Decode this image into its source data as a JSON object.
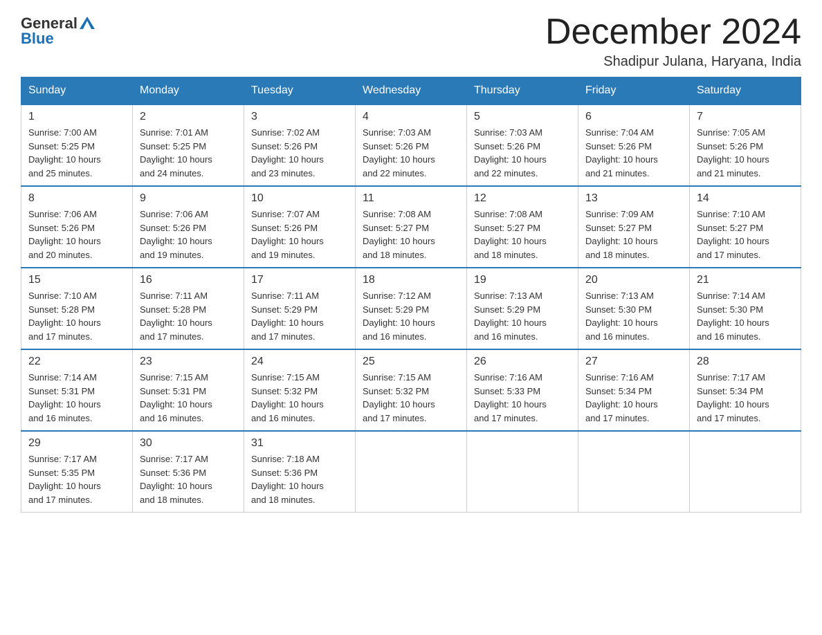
{
  "header": {
    "logo": {
      "general": "General",
      "blue": "Blue"
    },
    "title": "December 2024",
    "location": "Shadipur Julana, Haryana, India"
  },
  "days_of_week": [
    "Sunday",
    "Monday",
    "Tuesday",
    "Wednesday",
    "Thursday",
    "Friday",
    "Saturday"
  ],
  "weeks": [
    [
      {
        "day": "1",
        "sunrise": "7:00 AM",
        "sunset": "5:25 PM",
        "daylight": "10 hours and 25 minutes."
      },
      {
        "day": "2",
        "sunrise": "7:01 AM",
        "sunset": "5:25 PM",
        "daylight": "10 hours and 24 minutes."
      },
      {
        "day": "3",
        "sunrise": "7:02 AM",
        "sunset": "5:26 PM",
        "daylight": "10 hours and 23 minutes."
      },
      {
        "day": "4",
        "sunrise": "7:03 AM",
        "sunset": "5:26 PM",
        "daylight": "10 hours and 22 minutes."
      },
      {
        "day": "5",
        "sunrise": "7:03 AM",
        "sunset": "5:26 PM",
        "daylight": "10 hours and 22 minutes."
      },
      {
        "day": "6",
        "sunrise": "7:04 AM",
        "sunset": "5:26 PM",
        "daylight": "10 hours and 21 minutes."
      },
      {
        "day": "7",
        "sunrise": "7:05 AM",
        "sunset": "5:26 PM",
        "daylight": "10 hours and 21 minutes."
      }
    ],
    [
      {
        "day": "8",
        "sunrise": "7:06 AM",
        "sunset": "5:26 PM",
        "daylight": "10 hours and 20 minutes."
      },
      {
        "day": "9",
        "sunrise": "7:06 AM",
        "sunset": "5:26 PM",
        "daylight": "10 hours and 19 minutes."
      },
      {
        "day": "10",
        "sunrise": "7:07 AM",
        "sunset": "5:26 PM",
        "daylight": "10 hours and 19 minutes."
      },
      {
        "day": "11",
        "sunrise": "7:08 AM",
        "sunset": "5:27 PM",
        "daylight": "10 hours and 18 minutes."
      },
      {
        "day": "12",
        "sunrise": "7:08 AM",
        "sunset": "5:27 PM",
        "daylight": "10 hours and 18 minutes."
      },
      {
        "day": "13",
        "sunrise": "7:09 AM",
        "sunset": "5:27 PM",
        "daylight": "10 hours and 18 minutes."
      },
      {
        "day": "14",
        "sunrise": "7:10 AM",
        "sunset": "5:27 PM",
        "daylight": "10 hours and 17 minutes."
      }
    ],
    [
      {
        "day": "15",
        "sunrise": "7:10 AM",
        "sunset": "5:28 PM",
        "daylight": "10 hours and 17 minutes."
      },
      {
        "day": "16",
        "sunrise": "7:11 AM",
        "sunset": "5:28 PM",
        "daylight": "10 hours and 17 minutes."
      },
      {
        "day": "17",
        "sunrise": "7:11 AM",
        "sunset": "5:29 PM",
        "daylight": "10 hours and 17 minutes."
      },
      {
        "day": "18",
        "sunrise": "7:12 AM",
        "sunset": "5:29 PM",
        "daylight": "10 hours and 16 minutes."
      },
      {
        "day": "19",
        "sunrise": "7:13 AM",
        "sunset": "5:29 PM",
        "daylight": "10 hours and 16 minutes."
      },
      {
        "day": "20",
        "sunrise": "7:13 AM",
        "sunset": "5:30 PM",
        "daylight": "10 hours and 16 minutes."
      },
      {
        "day": "21",
        "sunrise": "7:14 AM",
        "sunset": "5:30 PM",
        "daylight": "10 hours and 16 minutes."
      }
    ],
    [
      {
        "day": "22",
        "sunrise": "7:14 AM",
        "sunset": "5:31 PM",
        "daylight": "10 hours and 16 minutes."
      },
      {
        "day": "23",
        "sunrise": "7:15 AM",
        "sunset": "5:31 PM",
        "daylight": "10 hours and 16 minutes."
      },
      {
        "day": "24",
        "sunrise": "7:15 AM",
        "sunset": "5:32 PM",
        "daylight": "10 hours and 16 minutes."
      },
      {
        "day": "25",
        "sunrise": "7:15 AM",
        "sunset": "5:32 PM",
        "daylight": "10 hours and 17 minutes."
      },
      {
        "day": "26",
        "sunrise": "7:16 AM",
        "sunset": "5:33 PM",
        "daylight": "10 hours and 17 minutes."
      },
      {
        "day": "27",
        "sunrise": "7:16 AM",
        "sunset": "5:34 PM",
        "daylight": "10 hours and 17 minutes."
      },
      {
        "day": "28",
        "sunrise": "7:17 AM",
        "sunset": "5:34 PM",
        "daylight": "10 hours and 17 minutes."
      }
    ],
    [
      {
        "day": "29",
        "sunrise": "7:17 AM",
        "sunset": "5:35 PM",
        "daylight": "10 hours and 17 minutes."
      },
      {
        "day": "30",
        "sunrise": "7:17 AM",
        "sunset": "5:36 PM",
        "daylight": "10 hours and 18 minutes."
      },
      {
        "day": "31",
        "sunrise": "7:18 AM",
        "sunset": "5:36 PM",
        "daylight": "10 hours and 18 minutes."
      },
      null,
      null,
      null,
      null
    ]
  ],
  "labels": {
    "sunrise": "Sunrise:",
    "sunset": "Sunset:",
    "daylight": "Daylight:"
  }
}
